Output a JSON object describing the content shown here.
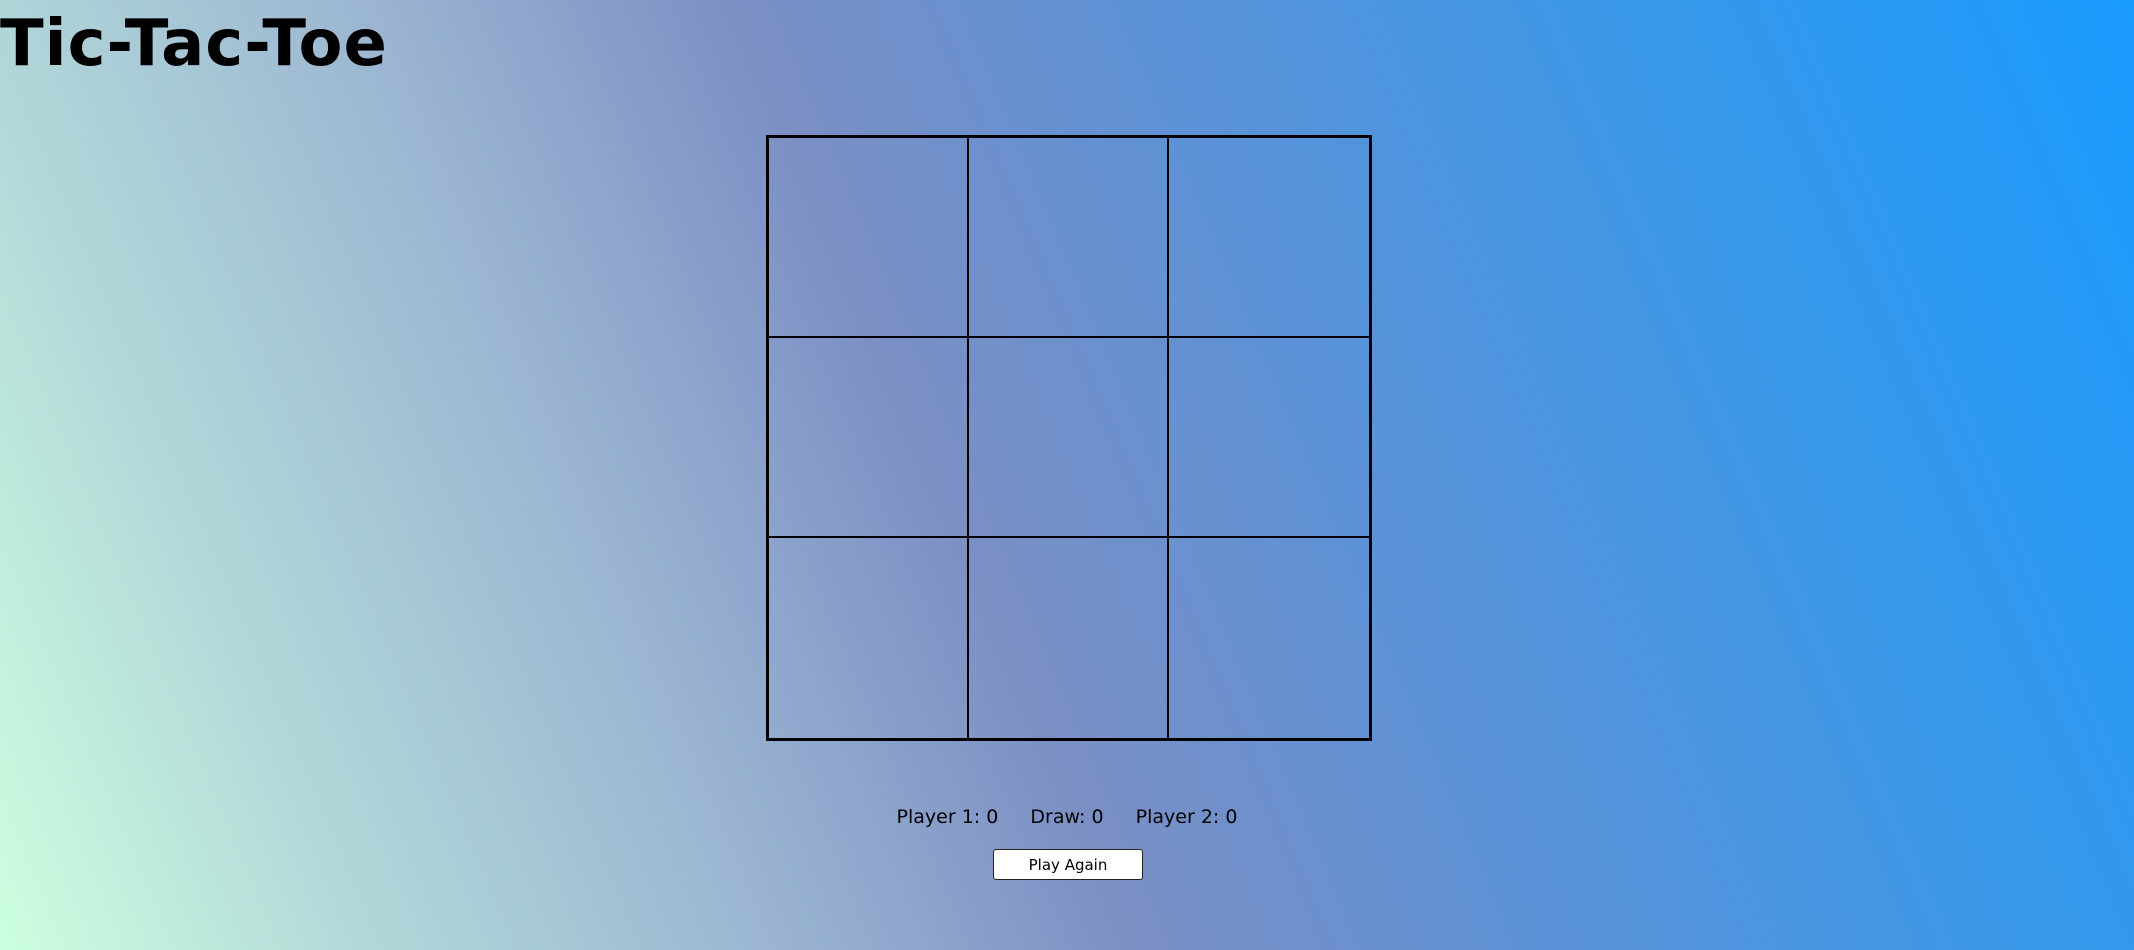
{
  "app": {
    "title": "Tic-Tac-Toe"
  },
  "board": {
    "cells": [
      "",
      "",
      "",
      "",
      "",
      "",
      "",
      "",
      ""
    ]
  },
  "score": {
    "player1_label": "Player 1:",
    "player1_value": "0",
    "draw_label": "Draw:",
    "draw_value": "0",
    "player2_label": "Player 2:",
    "player2_value": "0"
  },
  "actions": {
    "play_again_label": "Play Again"
  }
}
